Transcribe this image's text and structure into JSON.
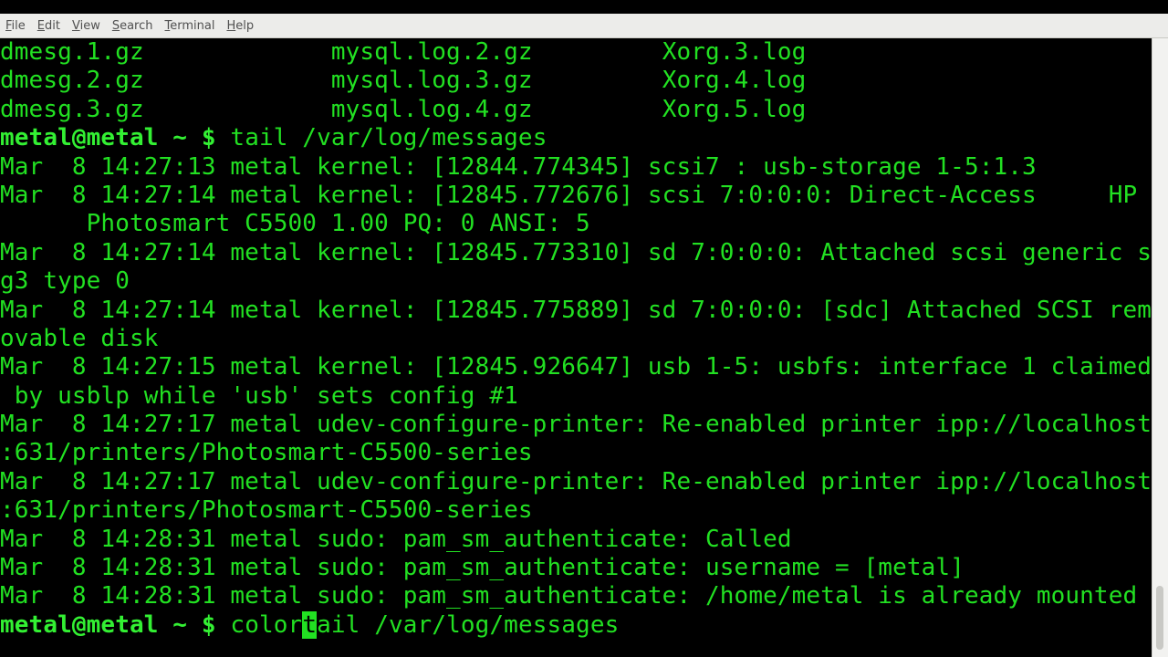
{
  "menu": {
    "items": [
      {
        "key": "F",
        "rest": "ile"
      },
      {
        "key": "E",
        "rest": "dit"
      },
      {
        "key": "V",
        "rest": "iew"
      },
      {
        "key": "S",
        "rest": "earch"
      },
      {
        "key": "T",
        "rest": "erminal"
      },
      {
        "key": "H",
        "rest": "elp"
      }
    ]
  },
  "terminal": {
    "ls_rows": [
      [
        "dmesg.1.gz",
        "mysql.log.2.gz",
        "Xorg.3.log"
      ],
      [
        "dmesg.2.gz",
        "mysql.log.3.gz",
        "Xorg.4.log"
      ],
      [
        "dmesg.3.gz",
        "mysql.log.4.gz",
        "Xorg.5.log"
      ]
    ],
    "prompt": "metal@metal ~ $",
    "command1": "tail /var/log/messages",
    "output_lines": [
      "Mar  8 14:27:13 metal kernel: [12844.774345] scsi7 : usb-storage 1-5:1.3",
      "Mar  8 14:27:14 metal kernel: [12845.772676] scsi 7:0:0:0: Direct-Access     HP",
      "      Photosmart C5500 1.00 PQ: 0 ANSI: 5",
      "Mar  8 14:27:14 metal kernel: [12845.773310] sd 7:0:0:0: Attached scsi generic s",
      "g3 type 0",
      "Mar  8 14:27:14 metal kernel: [12845.775889] sd 7:0:0:0: [sdc] Attached SCSI rem",
      "ovable disk",
      "Mar  8 14:27:15 metal kernel: [12845.926647] usb 1-5: usbfs: interface 1 claimed",
      " by usblp while 'usb' sets config #1",
      "Mar  8 14:27:17 metal udev-configure-printer: Re-enabled printer ipp://localhost",
      ":631/printers/Photosmart-C5500-series",
      "Mar  8 14:27:17 metal udev-configure-printer: Re-enabled printer ipp://localhost",
      ":631/printers/Photosmart-C5500-series",
      "Mar  8 14:28:31 metal sudo: pam_sm_authenticate: Called",
      "Mar  8 14:28:31 metal sudo: pam_sm_authenticate: username = [metal]",
      "Mar  8 14:28:31 metal sudo: pam_sm_authenticate: /home/metal is already mounted"
    ],
    "command2_before_cursor": "color",
    "command2_cursor_char": "t",
    "command2_after_cursor": "ail /var/log/messages"
  },
  "colors": {
    "terminal_text": "#22e022",
    "terminal_bg": "#000000",
    "menubar_bg": "#ececea"
  }
}
